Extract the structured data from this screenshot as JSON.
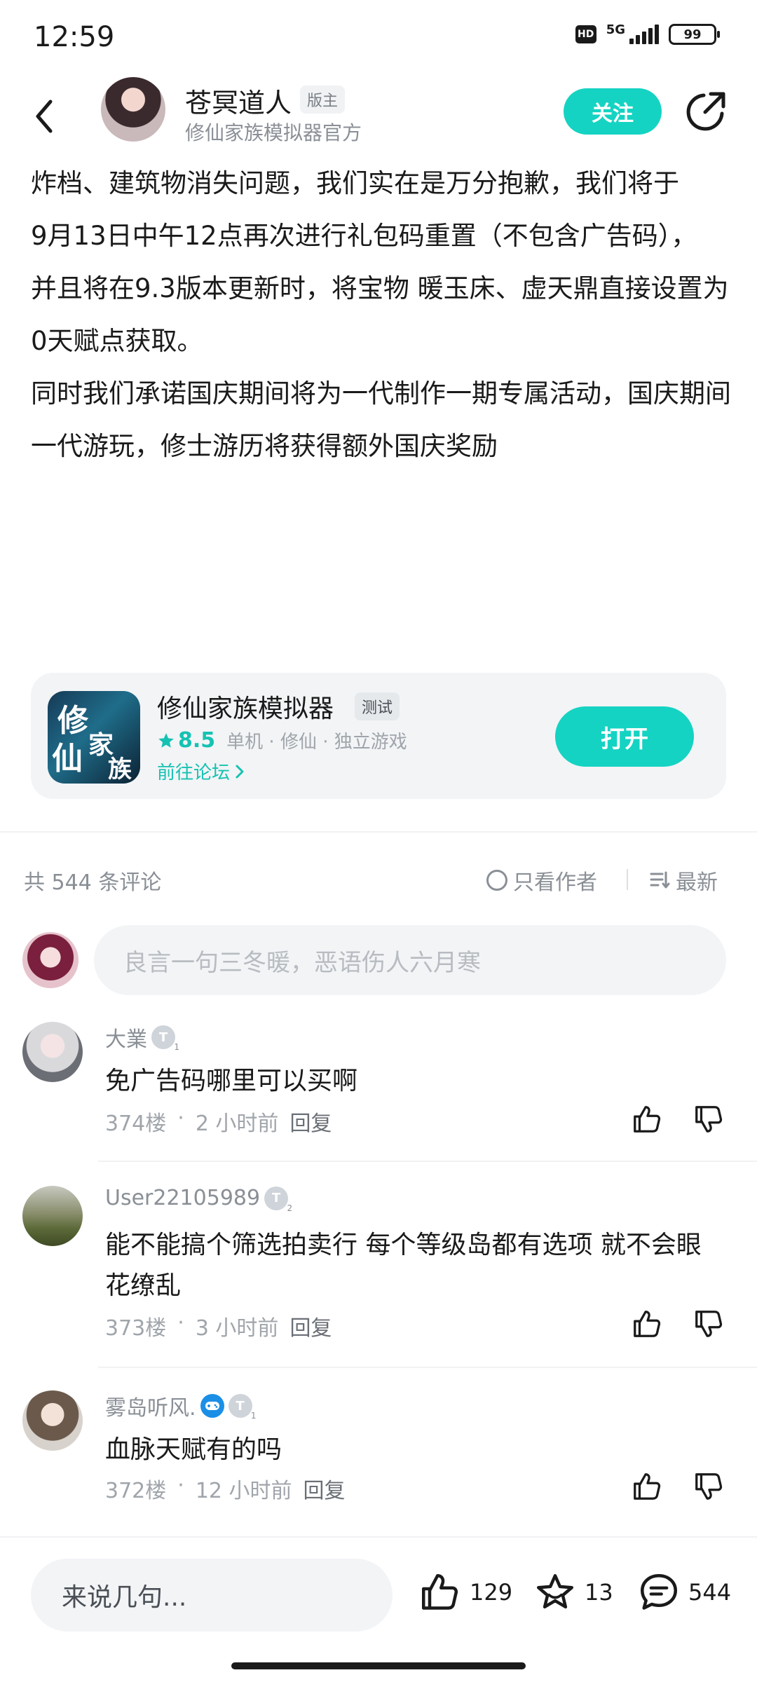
{
  "status_bar": {
    "time": "12:59",
    "hd": "HD",
    "network": "5G",
    "battery": "99"
  },
  "header": {
    "author_name": "苍冥道人",
    "author_badge": "版主",
    "author_subtitle": "修仙家族模拟器官方",
    "follow_label": "关注"
  },
  "article": {
    "paragraphs": [
      "炸档、建筑物消失问题，我们实在是万分抱歉，我们将于",
      "9月13日中午12点再次进行礼包码重置（不包含广告码），",
      "并且将在9.3版本更新时，将宝物 暖玉床、虚天鼎直接设置为0天赋点获取。",
      "同时我们承诺国庆期间将为一代制作一期专属活动，国庆期间一代游玩，修士游历将获得额外国庆奖励"
    ]
  },
  "game_card": {
    "name": "修仙家族模拟器",
    "tag": "测试",
    "rating": "8.5",
    "tags": "单机 · 修仙 · 独立游戏",
    "forum_link": "前往论坛",
    "open_label": "打开",
    "icon_chars": [
      "修",
      "仙",
      "家",
      "族"
    ]
  },
  "comments_header": {
    "count_text": "共 544 条评论",
    "author_only": "只看作者",
    "sort_label": "最新"
  },
  "comment_input": {
    "placeholder": "良言一句三冬暖，恶语伤人六月寒"
  },
  "comments": [
    {
      "user": "大業",
      "level": "T",
      "level_num": "1",
      "text": "免广告码哪里可以买啊",
      "floor": "374楼",
      "time": "2 小时前",
      "reply": "回复"
    },
    {
      "user": "User22105989",
      "level": "T",
      "level_num": "2",
      "text": "能不能搞个筛选拍卖行  每个等级岛都有选项  就不会眼花缭乱",
      "floor": "373楼",
      "time": "3 小时前",
      "reply": "回复"
    },
    {
      "user": "雾岛听风.",
      "level": "T",
      "level_num": "1",
      "text": "血脉天赋有的吗",
      "floor": "372楼",
      "time": "12 小时前",
      "reply": "回复"
    }
  ],
  "bottom_bar": {
    "input_placeholder": "来说几句...",
    "likes": "129",
    "favorites": "13",
    "comments": "544"
  },
  "colors": {
    "accent": "#15d3c2",
    "text": "#1a1a1a",
    "muted": "#8a8f96"
  }
}
